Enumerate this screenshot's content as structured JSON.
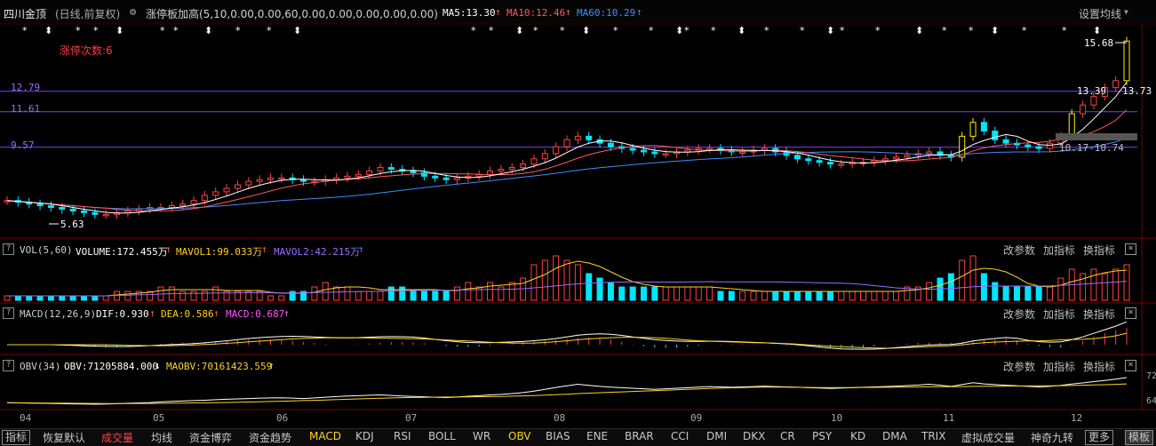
{
  "header": {
    "stock_name": "四川金顶",
    "period_info": "(日线,前复权)",
    "indicator": "涨停板加高(5,10,0.00,0.00,60,0.00,0.00,0.00,0.00,0.00)",
    "ma5": "MA5:13.30",
    "ma10": "MA10:12.46",
    "ma60": "MA60:10.29",
    "settings": "设置均线",
    "gear_icon": "gear-icon",
    "colors": {
      "ma5": "#ffffff",
      "ma10": "#ff5a5a",
      "ma60": "#3f8cff"
    }
  },
  "main_chart": {
    "limit_up_count": "涨停次数:6",
    "level_labels": [
      "12.79",
      "11.61",
      "9.57"
    ],
    "level_values": [
      12.79,
      11.61,
      9.57
    ],
    "price_high": "15.68",
    "price_low": "5.63",
    "label_mid": "13.39",
    "label_mid_right": "13.73",
    "label_range": "10.17-10.74",
    "star_marker": "*",
    "arrow_marker": "⬍"
  },
  "vol_panel": {
    "title": "VOL(5,60)",
    "volume": "VOLUME:172.455万",
    "mavol1": "MAVOL1:99.033万",
    "mavol2": "MAVOL2:42.215万"
  },
  "macd_panel": {
    "title": "MACD(12,26,9)",
    "dif": "DIF:0.930",
    "dea": "DEA:0.586",
    "macd": "MACD:0.687"
  },
  "obv_panel": {
    "title": "OBV(34)",
    "obv": "OBV:71205884.000",
    "maobv": "MAOBV:70161423.559",
    "scale_top": "72",
    "scale_bottom": "64"
  },
  "panel_buttons": {
    "change_params": "改参数",
    "add_indicator": "加指标",
    "switch_indicator": "换指标",
    "close": "×",
    "question": "?"
  },
  "x_axis": [
    "04",
    "05",
    "06",
    "07",
    "08",
    "09",
    "10",
    "11",
    "12"
  ],
  "tabs": [
    "指标",
    "恢复默认",
    "成交量",
    "均线",
    "资金博弈",
    "资金趋势",
    "MACD",
    "KDJ",
    "RSI",
    "BOLL",
    "WR",
    "OBV",
    "BIAS",
    "ENE",
    "BRAR",
    "CCI",
    "DMI",
    "DKX",
    "CR",
    "PSY",
    "KD",
    "DMA",
    "TRIX",
    "虚拟成交量",
    "神奇九转",
    "更多",
    "模板"
  ],
  "chart_data": {
    "type": "candlestick",
    "months": [
      "04",
      "05",
      "06",
      "07",
      "08",
      "09",
      "10",
      "11",
      "12"
    ],
    "price_range": [
      5.63,
      15.68
    ],
    "horizontal_levels": [
      12.79,
      11.61,
      9.57
    ],
    "annotations": {
      "high": 15.68,
      "low": 5.63
    },
    "close_series": [
      6.5,
      6.4,
      6.3,
      6.2,
      6.1,
      6.0,
      5.9,
      5.8,
      5.7,
      5.7,
      5.8,
      5.9,
      6.0,
      6.1,
      6.1,
      6.2,
      6.3,
      6.5,
      6.8,
      7.0,
      7.2,
      7.4,
      7.6,
      7.7,
      7.8,
      7.8,
      7.7,
      7.6,
      7.6,
      7.7,
      7.8,
      7.9,
      8.0,
      8.2,
      8.4,
      8.3,
      8.2,
      8.1,
      7.9,
      7.8,
      7.7,
      7.8,
      7.9,
      8.0,
      8.2,
      8.3,
      8.4,
      8.6,
      8.9,
      9.2,
      9.6,
      10.0,
      10.2,
      10.0,
      9.8,
      9.6,
      9.5,
      9.4,
      9.3,
      9.2,
      9.2,
      9.3,
      9.4,
      9.5,
      9.5,
      9.4,
      9.3,
      9.3,
      9.4,
      9.5,
      9.3,
      9.1,
      8.9,
      8.8,
      8.7,
      8.6,
      8.6,
      8.7,
      8.7,
      8.8,
      8.9,
      9.0,
      9.1,
      9.2,
      9.3,
      9.1,
      9.0,
      10.2,
      11.0,
      10.5,
      10.0,
      9.8,
      9.7,
      9.6,
      9.5,
      9.8,
      10.2,
      11.5,
      12.0,
      12.5,
      13.0,
      13.4,
      15.68
    ],
    "volume_series": [
      1,
      1,
      1,
      1,
      1,
      1,
      1,
      1,
      1,
      1,
      2,
      2,
      2,
      2,
      3,
      3,
      2,
      2,
      2,
      3,
      2,
      2,
      2,
      2,
      1,
      1,
      2,
      2,
      3,
      4,
      3,
      3,
      2,
      2,
      2,
      3,
      3,
      2,
      2,
      2,
      2,
      3,
      4,
      3,
      4,
      3,
      4,
      5,
      8,
      9,
      10,
      9,
      8,
      6,
      5,
      4,
      3,
      3,
      3,
      3,
      3,
      3,
      3,
      3,
      3,
      2,
      2,
      2,
      2,
      2,
      2,
      2,
      2,
      2,
      2,
      2,
      2,
      2,
      2,
      2,
      2,
      2,
      3,
      3,
      4,
      5,
      6,
      9,
      10,
      6,
      4,
      3,
      3,
      3,
      3,
      3,
      5,
      7,
      6,
      7,
      6,
      7,
      8
    ],
    "obv_range": [
      64,
      72
    ]
  }
}
